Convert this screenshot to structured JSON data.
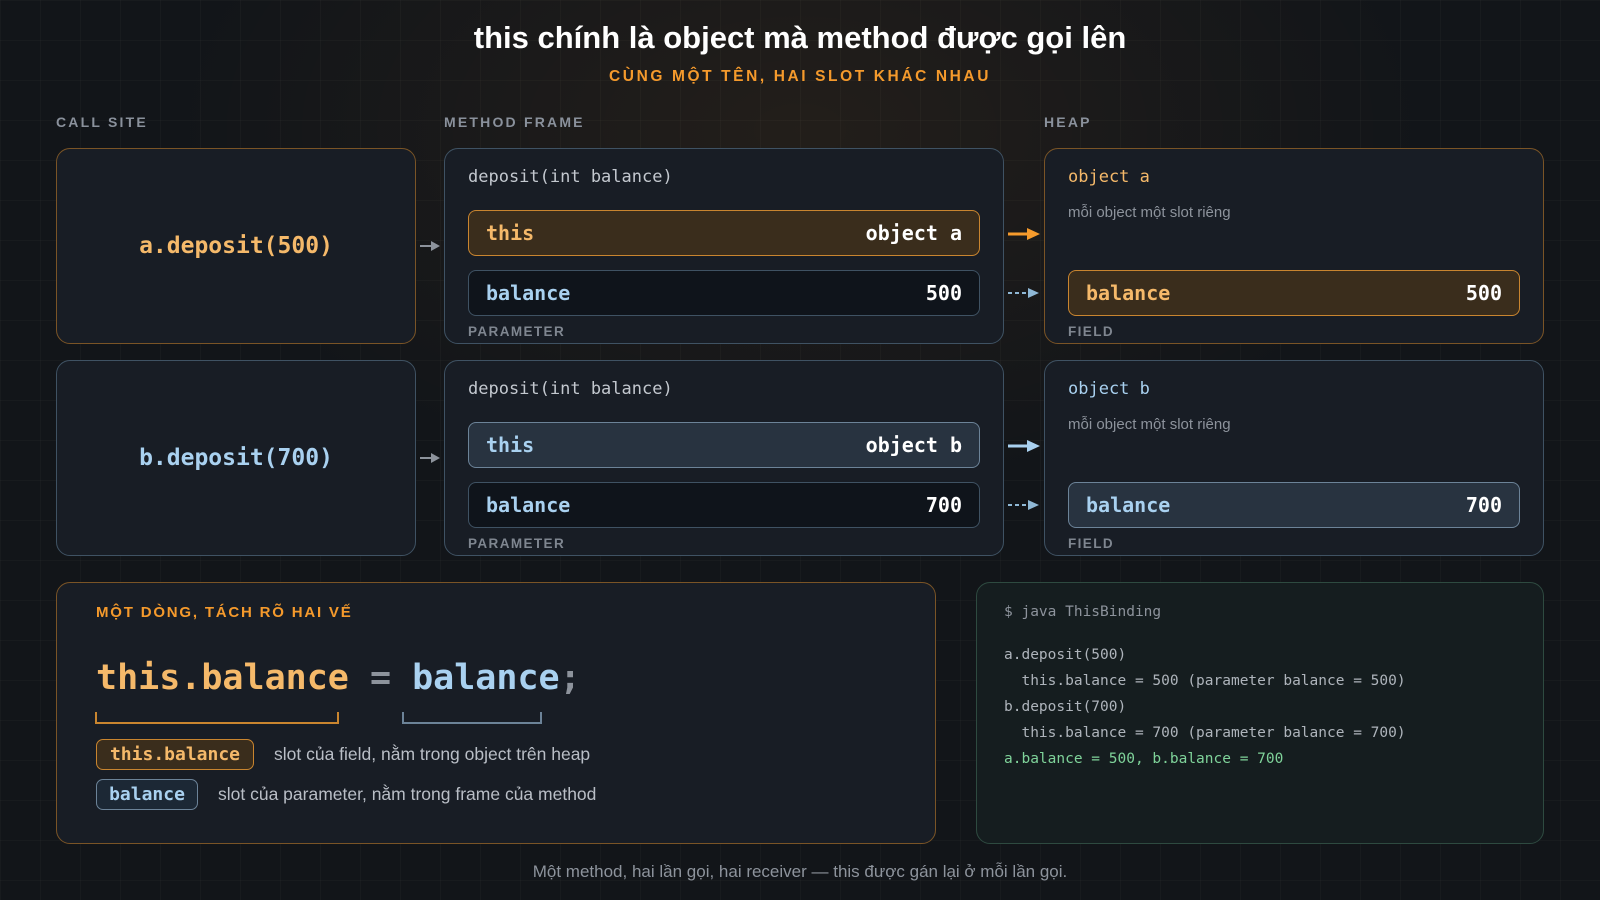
{
  "title": "this chính là object mà method được gọi lên",
  "subtitle": "CÙNG MỘT TÊN, HAI SLOT KHÁC NHAU",
  "columns": {
    "call_site": "CALL SITE",
    "method_frame": "METHOD FRAME",
    "heap": "HEAP"
  },
  "rows": [
    {
      "call": "a.deposit(500)",
      "signature": "deposit(int balance)",
      "this_label": "this",
      "this_value": "object a",
      "param_label": "balance",
      "param_value": "500",
      "param_caption": "PARAMETER",
      "object_name": "object a",
      "object_note": "mỗi object một slot riêng",
      "field_label": "balance",
      "field_value": "500",
      "field_caption": "FIELD"
    },
    {
      "call": "b.deposit(700)",
      "signature": "deposit(int balance)",
      "this_label": "this",
      "this_value": "object b",
      "param_label": "balance",
      "param_value": "700",
      "param_caption": "PARAMETER",
      "object_name": "object b",
      "object_note": "mỗi object một slot riêng",
      "field_label": "balance",
      "field_value": "700",
      "field_caption": "FIELD"
    }
  ],
  "explain": {
    "heading": "MỘT DÒNG, TÁCH RÕ HAI VẾ",
    "statement": {
      "lhs": "this.balance",
      "op": " = ",
      "rhs": "balance",
      "end": ";"
    },
    "tags": [
      {
        "label": "this.balance",
        "desc": "slot của field, nằm trong object trên heap"
      },
      {
        "label": "balance",
        "desc": "slot của parameter, nằm trong frame của method"
      }
    ]
  },
  "terminal": {
    "prompt": "$ java ThisBinding",
    "lines": [
      "a.deposit(500)",
      "  this.balance = 500 (parameter balance = 500)",
      "b.deposit(700)",
      "  this.balance = 700 (parameter balance = 700)"
    ],
    "result": "a.balance = 500, b.balance = 700"
  },
  "footer": "Một method, hai lần gọi, hai receiver — this được gán lại ở mỗi lần gọi.",
  "colors": {
    "accent_orange": "#f59a2c",
    "accent_blue": "#a9d1f0",
    "terminal_green": "#7fd39a",
    "background": "#121519"
  }
}
